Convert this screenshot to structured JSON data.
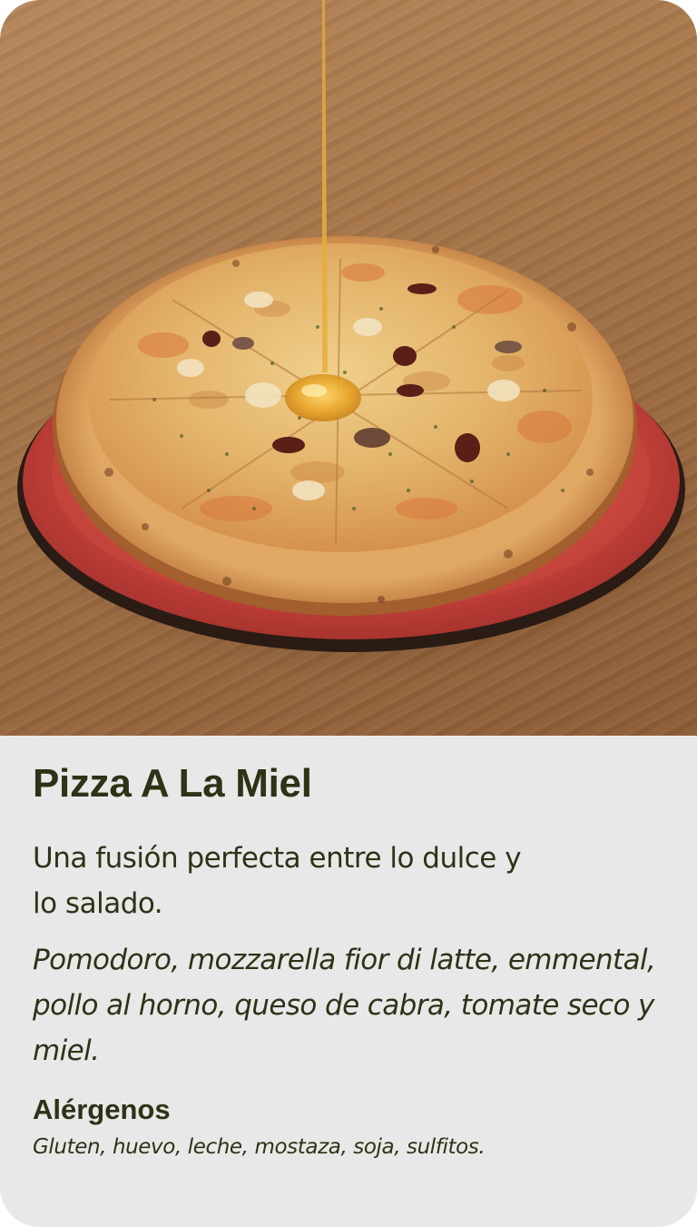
{
  "product": {
    "image_alt": "Pizza con miel sobre plato rojo",
    "name": "Pizza A La Miel",
    "description": "Una fusión perfecta entre lo dulce y lo salado.",
    "ingredients": "Pomodoro, mozzarella fior di latte, emmental, pollo al horno, queso de cabra, tomate seco y miel.",
    "allergens_heading": "Alérgenos",
    "allergens": "Gluten, huevo, leche, mostaza, soja, sulfitos."
  },
  "colors": {
    "text": "#2c3316",
    "panel_background": "#e8e8e8",
    "plate": "#c8443c",
    "wood": "#a67649"
  },
  "icons": {
    "photo": "pizza-photo"
  }
}
